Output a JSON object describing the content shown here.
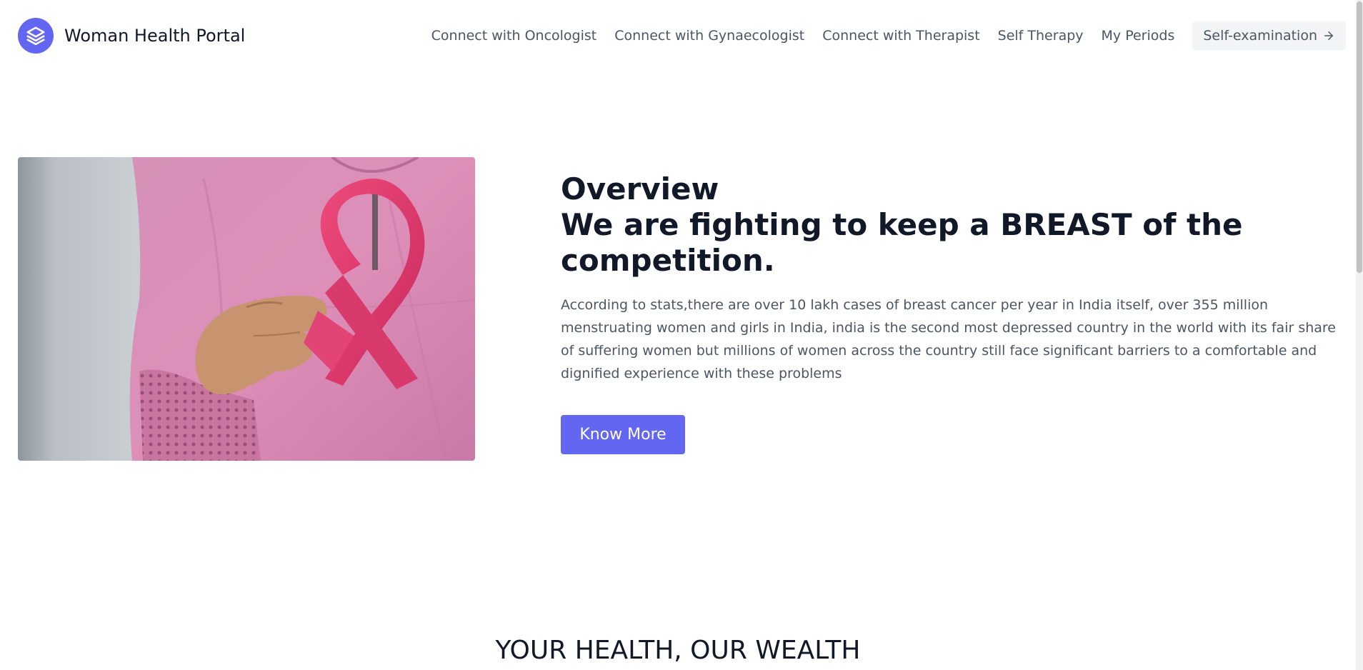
{
  "header": {
    "brand_name": "Woman Health Portal",
    "nav": [
      {
        "label": "Connect with Oncologist"
      },
      {
        "label": "Connect with Gynaecologist"
      },
      {
        "label": "Connect with Therapist"
      },
      {
        "label": "Self Therapy"
      },
      {
        "label": "My Periods"
      }
    ],
    "cta_label": "Self-examination"
  },
  "hero": {
    "title_line1": "Overview",
    "title_line2": "We are fighting to keep a BREAST of the competition.",
    "description": "According to stats,there are over 10 lakh cases of breast cancer per year in India itself, over 355 million menstruating women and girls in India, india is the second most depressed country in the world with its fair share of suffering women but millions of women across the country still face significant barriers to a comfortable and dignified experience with these problems",
    "button_label": "Know More"
  },
  "section": {
    "title": "YOUR HEALTH, OUR WEALTH"
  },
  "colors": {
    "accent": "#6366f1",
    "text_dark": "#111827",
    "text_muted": "#4b5563",
    "cta_bg": "#f3f4f6",
    "ribbon": "#e0336b",
    "shirt": "#d98bb4"
  },
  "icons": {
    "logo": "layers-icon",
    "cta_arrow": "arrow-right-icon"
  }
}
